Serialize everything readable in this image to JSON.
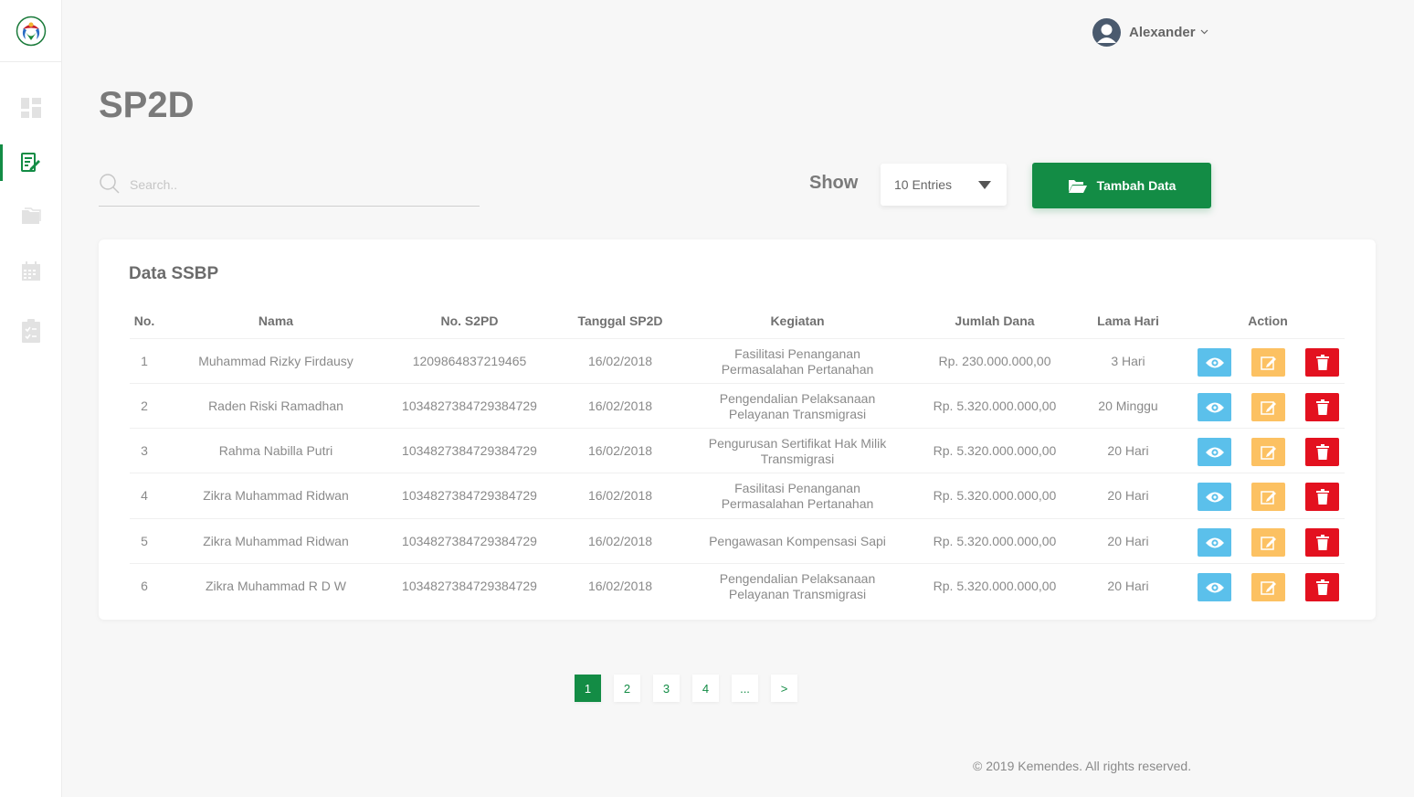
{
  "user": {
    "name": "Alexander"
  },
  "page": {
    "title": "SP2D"
  },
  "search": {
    "placeholder": "Search.."
  },
  "show": {
    "label": "Show",
    "selected": "10 Entries"
  },
  "add_button": {
    "label": "Tambah Data"
  },
  "card": {
    "title": "Data SSBP"
  },
  "table": {
    "headers": [
      "No.",
      "Nama",
      "No. S2PD",
      "Tanggal SP2D",
      "Kegiatan",
      "Jumlah Dana",
      "Lama Hari",
      "Action"
    ],
    "rows": [
      {
        "no": "1",
        "nama": "Muhammad Rizky Firdausy",
        "s2pd": "1209864837219465",
        "tanggal": "16/02/2018",
        "kegiatan": "Fasilitasi Penanganan Permasalahan Pertanahan",
        "dana": "Rp. 230.000.000,00",
        "lama": "3 Hari"
      },
      {
        "no": "2",
        "nama": "Raden Riski Ramadhan",
        "s2pd": "1034827384729384729",
        "tanggal": "16/02/2018",
        "kegiatan": "Pengendalian Pelaksanaan Pelayanan Transmigrasi",
        "dana": "Rp. 5.320.000.000,00",
        "lama": "20 Minggu"
      },
      {
        "no": "3",
        "nama": "Rahma Nabilla Putri",
        "s2pd": "1034827384729384729",
        "tanggal": "16/02/2018",
        "kegiatan": "Pengurusan Sertifikat Hak Milik Transmigrasi",
        "dana": "Rp. 5.320.000.000,00",
        "lama": "20 Hari"
      },
      {
        "no": "4",
        "nama": "Zikra Muhammad Ridwan",
        "s2pd": "1034827384729384729",
        "tanggal": "16/02/2018",
        "kegiatan": "Fasilitasi Penanganan Permasalahan Pertanahan",
        "dana": "Rp. 5.320.000.000,00",
        "lama": "20 Hari"
      },
      {
        "no": "5",
        "nama": "Zikra Muhammad Ridwan",
        "s2pd": "1034827384729384729",
        "tanggal": "16/02/2018",
        "kegiatan": "Pengawasan Kompensasi Sapi",
        "dana": "Rp. 5.320.000.000,00",
        "lama": "20 Hari"
      },
      {
        "no": "6",
        "nama": "Zikra Muhammad R D W",
        "s2pd": "1034827384729384729",
        "tanggal": "16/02/2018",
        "kegiatan": "Pengendalian Pelaksanaan Pelayanan Transmigrasi",
        "dana": "Rp. 5.320.000.000,00",
        "lama": "20 Hari"
      }
    ]
  },
  "pagination": [
    "1",
    "2",
    "3",
    "4",
    "...",
    ">"
  ],
  "footer": {
    "text": "© 2019 Kemendes. All rights reserved."
  },
  "colors": {
    "primary": "#138c45",
    "view": "#5bc0eb",
    "edit": "#fcc162",
    "delete": "#e3111f"
  }
}
